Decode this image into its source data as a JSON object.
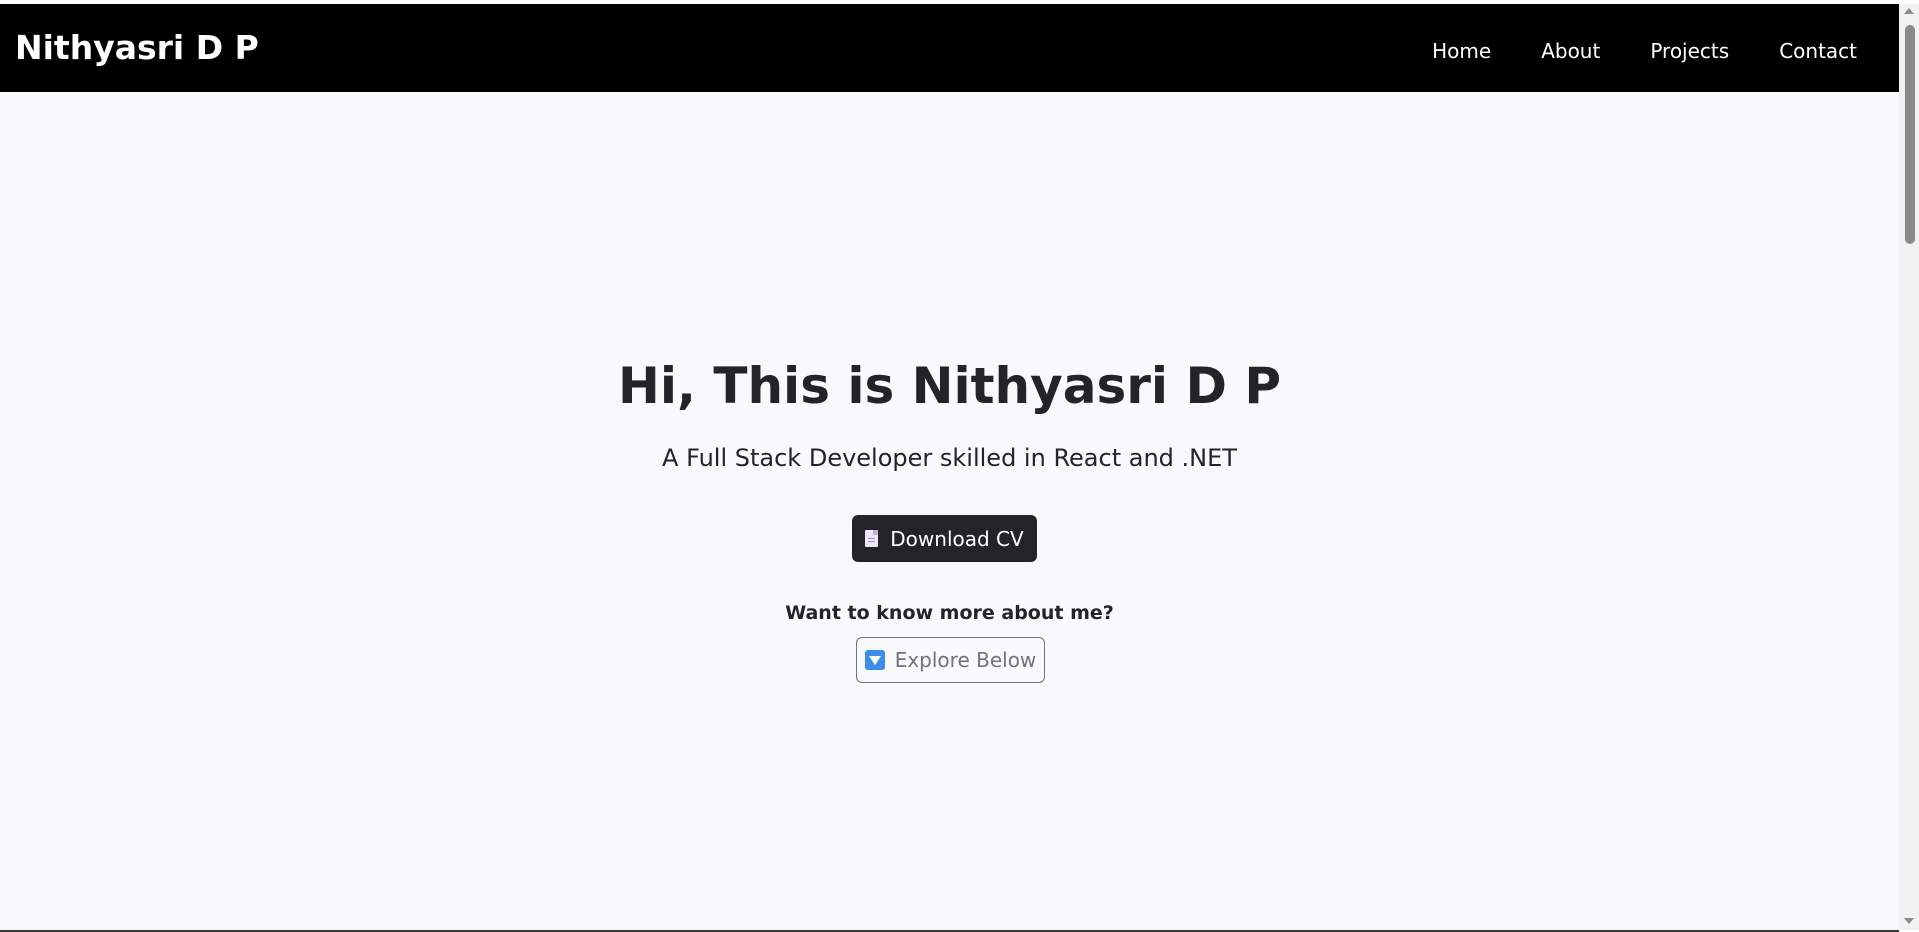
{
  "navbar": {
    "brand": "Nithyasri D P",
    "links": [
      "Home",
      "About",
      "Projects",
      "Contact"
    ]
  },
  "hero": {
    "title": "Hi, This is Nithyasri D P",
    "subtitle": "A Full Stack Developer skilled in React and .NET",
    "download_label": "Download CV",
    "know_more_text": "Want to know more about me?",
    "explore_label": "Explore Below"
  },
  "icons": {
    "download": "page-facing-up-icon",
    "explore": "down-arrow-button-icon"
  },
  "colors": {
    "navbar_bg": "#000000",
    "page_bg": "#f8f9fa",
    "dark_button": "#212529",
    "outline_button": "#6c757d"
  }
}
